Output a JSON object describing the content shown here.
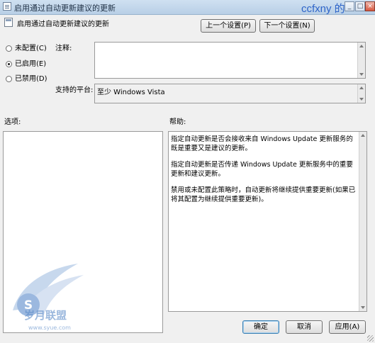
{
  "window": {
    "title": "启用通过自动更新建议的更新",
    "watermark_top": "ccfxny 的",
    "minimize_glyph": "_",
    "maximize_glyph": "□",
    "close_glyph": "×"
  },
  "header": {
    "setting_title": "启用通过自动更新建议的更新",
    "prev_button": "上一个设置(P)",
    "next_button": "下一个设置(N)"
  },
  "state": {
    "not_configured": "未配置(C)",
    "enabled": "已启用(E)",
    "disabled": "已禁用(D)",
    "selected": "enabled"
  },
  "comment": {
    "label": "注释:",
    "value": ""
  },
  "platform": {
    "label": "支持的平台:",
    "value": "至少 Windows Vista"
  },
  "options": {
    "label": "选项:"
  },
  "help": {
    "label": "帮助:",
    "paragraphs": [
      "指定自动更新是否会接收来自 Windows Update 更新服务的既是重要又是建议的更新。",
      "指定自动更新是否传递 Windows Update 更新服务中的重要更新和建议更新。",
      "禁用或未配置此策略时，自动更新将继续提供重要更新(如果已将其配置为继续提供重要更新)。"
    ]
  },
  "footer": {
    "ok_button": "确定",
    "cancel_button": "取消",
    "apply_button": "应用(A)"
  },
  "watermark": {
    "text": "岁月联盟",
    "url_text": "www.syue.com",
    "logo_letter": "S"
  },
  "colors": {
    "title_gradient_top": "#cfe0f1",
    "title_gradient_bottom": "#b8cfe6",
    "watermark_blue": "#2e64c8"
  }
}
